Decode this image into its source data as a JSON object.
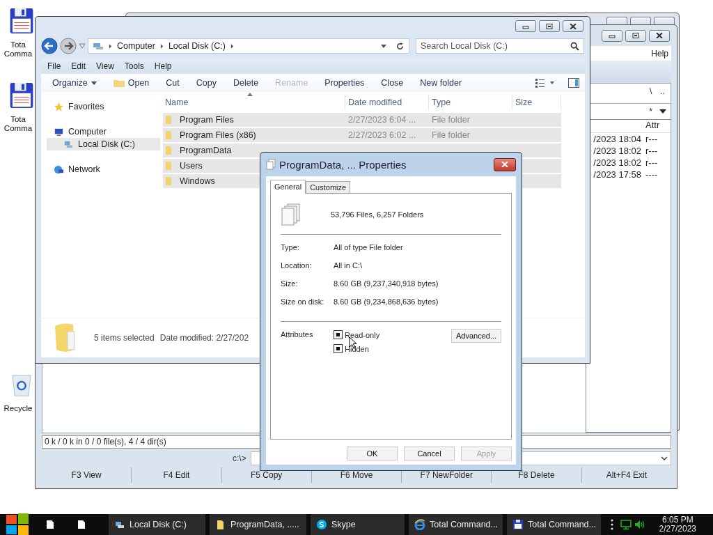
{
  "desktop_icons": [
    {
      "kind": "floppy",
      "label_lines": [
        "Tota",
        "Comma"
      ]
    },
    {
      "kind": "floppy",
      "label_lines": [
        "Tota",
        "Comma"
      ]
    },
    {
      "kind": "recycle",
      "label_lines": [
        "Recycle"
      ]
    }
  ],
  "total_commander": {
    "menu": [
      "Help"
    ],
    "path_buttons": [
      "\\",
      ".."
    ],
    "filter": "*",
    "columns": [
      "Attr"
    ],
    "rows": [
      {
        "date": "/2023 18:04",
        "attr": "r---"
      },
      {
        "date": "/2023 18:02",
        "attr": "r---"
      },
      {
        "date": "/2023 18:02",
        "attr": "r---"
      },
      {
        "date": "/2023 17:58",
        "attr": "----"
      }
    ],
    "status": "0 k / 0 k in 0 / 0 file(s), 4 / 4 dir(s)",
    "command_prompt": "c:\\>",
    "function_keys": [
      "F3 View",
      "F4 Edit",
      "F5 Copy",
      "F6 Move",
      "F7 NewFolder",
      "F8 Delete",
      "Alt+F4 Exit"
    ]
  },
  "explorer": {
    "breadcrumb": [
      "Computer",
      "Local Disk (C:)"
    ],
    "search": {
      "placeholder": "Search Local Disk (C:)"
    },
    "menu": [
      "File",
      "Edit",
      "View",
      "Tools",
      "Help"
    ],
    "commands": [
      {
        "label": "Organize",
        "kind": "menu",
        "disabled": false
      },
      {
        "label": "Open",
        "kind": "folder",
        "disabled": false
      },
      {
        "label": "Cut",
        "kind": "plain",
        "disabled": false
      },
      {
        "label": "Copy",
        "kind": "plain",
        "disabled": false
      },
      {
        "label": "Delete",
        "kind": "plain",
        "disabled": false
      },
      {
        "label": "Rename",
        "kind": "plain",
        "disabled": true
      },
      {
        "label": "Properties",
        "kind": "plain",
        "disabled": false
      },
      {
        "label": "Close",
        "kind": "plain",
        "disabled": false
      },
      {
        "label": "New folder",
        "kind": "plain",
        "disabled": false
      }
    ],
    "nav": [
      {
        "label": "Favorites",
        "kind": "star",
        "selected": false
      },
      {
        "label": "Computer",
        "kind": "computer",
        "selected": false,
        "children": [
          {
            "label": "Local Disk (C:)",
            "kind": "drive",
            "selected": true
          }
        ]
      },
      {
        "label": "Network",
        "kind": "network",
        "selected": false
      }
    ],
    "columns": [
      "Name",
      "Date modified",
      "Type",
      "Size"
    ],
    "rows": [
      {
        "name": "Program Files",
        "date": "2/27/2023 6:04 ...",
        "type": "File folder",
        "selected": true
      },
      {
        "name": "Program Files (x86)",
        "date": "2/27/2023 6:02 ...",
        "type": "File folder",
        "selected": true
      },
      {
        "name": "ProgramData",
        "selected": true
      },
      {
        "name": "Users",
        "selected": true
      },
      {
        "name": "Windows",
        "selected": true
      }
    ],
    "details": {
      "summary": "5 items selected",
      "date": "Date modified: 2/27/202"
    }
  },
  "dialog": {
    "title": "ProgramData, ... Properties",
    "tabs": [
      {
        "label": "General",
        "selected": true
      },
      {
        "label": "Customize",
        "selected": false
      }
    ],
    "summary": "53,796 Files, 6,257 Folders",
    "fields": [
      {
        "label": "Type:",
        "value": "All of type File folder"
      },
      {
        "label": "Location:",
        "value": "All in C:\\"
      },
      {
        "label": "Size:",
        "value": "8.60 GB (9,237,340,918 bytes)"
      },
      {
        "label": "Size on disk:",
        "value": "8.60 GB (9,234,868,636 bytes)"
      }
    ],
    "attributes_label": "Attributes",
    "attributes": [
      {
        "label": "Read-only",
        "indeterminate": true
      },
      {
        "label": "Hidden",
        "indeterminate": true
      }
    ],
    "advanced_button": "Advanced...",
    "buttons": [
      {
        "label": "OK",
        "disabled": false
      },
      {
        "label": "Cancel",
        "disabled": false
      },
      {
        "label": "Apply",
        "disabled": true
      }
    ]
  },
  "taskbar": {
    "tasks": [
      {
        "label": "Local Disk (C:)",
        "kind": "drive"
      },
      {
        "label": "ProgramData, .....",
        "kind": "folder"
      },
      {
        "label": "Skype",
        "kind": "skype"
      },
      {
        "label": "Total Command...",
        "kind": "browser"
      },
      {
        "label": "Total Command...",
        "kind": "floppy"
      }
    ],
    "clock": {
      "time": "6:05 PM",
      "date": "2/27/2023"
    }
  }
}
